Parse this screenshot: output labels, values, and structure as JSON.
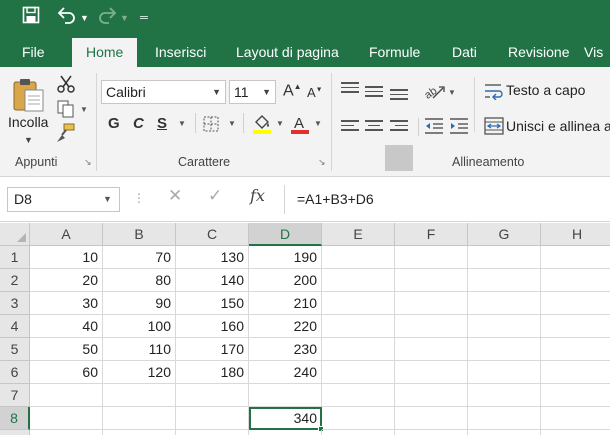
{
  "quick_access": {
    "save_icon": "save-icon",
    "undo_icon": "undo-icon",
    "redo_icon": "redo-icon",
    "customize_icon": "customize-quick-access-icon"
  },
  "tabs": [
    "File",
    "Home",
    "Inserisci",
    "Layout di pagina",
    "Formule",
    "Dati",
    "Revisione",
    "Vis"
  ],
  "active_tab": "Home",
  "ribbon": {
    "clipboard": {
      "paste_label": "Incolla",
      "group_label": "Appunti"
    },
    "font": {
      "font_name": "Calibri",
      "font_size": "11",
      "bold": "G",
      "italic": "C",
      "underline": "S",
      "group_label": "Carattere"
    },
    "alignment": {
      "wrap_text": "Testo a capo",
      "merge_center": "Unisci e allinea al",
      "group_label": "Allineamento"
    }
  },
  "formula_bar": {
    "name_box": "D8",
    "fx_label": "fx",
    "formula": "=A1+B3+D6"
  },
  "grid": {
    "columns": [
      "A",
      "B",
      "C",
      "D",
      "E",
      "F",
      "G",
      "H"
    ],
    "rows": [
      "1",
      "2",
      "3",
      "4",
      "5",
      "6",
      "7",
      "8"
    ],
    "selected_cell": "D8",
    "cells": [
      [
        "10",
        "70",
        "130",
        "190"
      ],
      [
        "20",
        "80",
        "140",
        "200"
      ],
      [
        "30",
        "90",
        "150",
        "210"
      ],
      [
        "40",
        "100",
        "160",
        "220"
      ],
      [
        "50",
        "110",
        "170",
        "230"
      ],
      [
        "60",
        "120",
        "180",
        "240"
      ],
      [
        "",
        "",
        "",
        ""
      ],
      [
        "",
        "",
        "",
        "340"
      ]
    ]
  },
  "colors": {
    "brand": "#217346",
    "ribbon_bg": "#f3f3f3",
    "header_bg": "#e6e6e6",
    "gridline": "#d9d9d9"
  }
}
